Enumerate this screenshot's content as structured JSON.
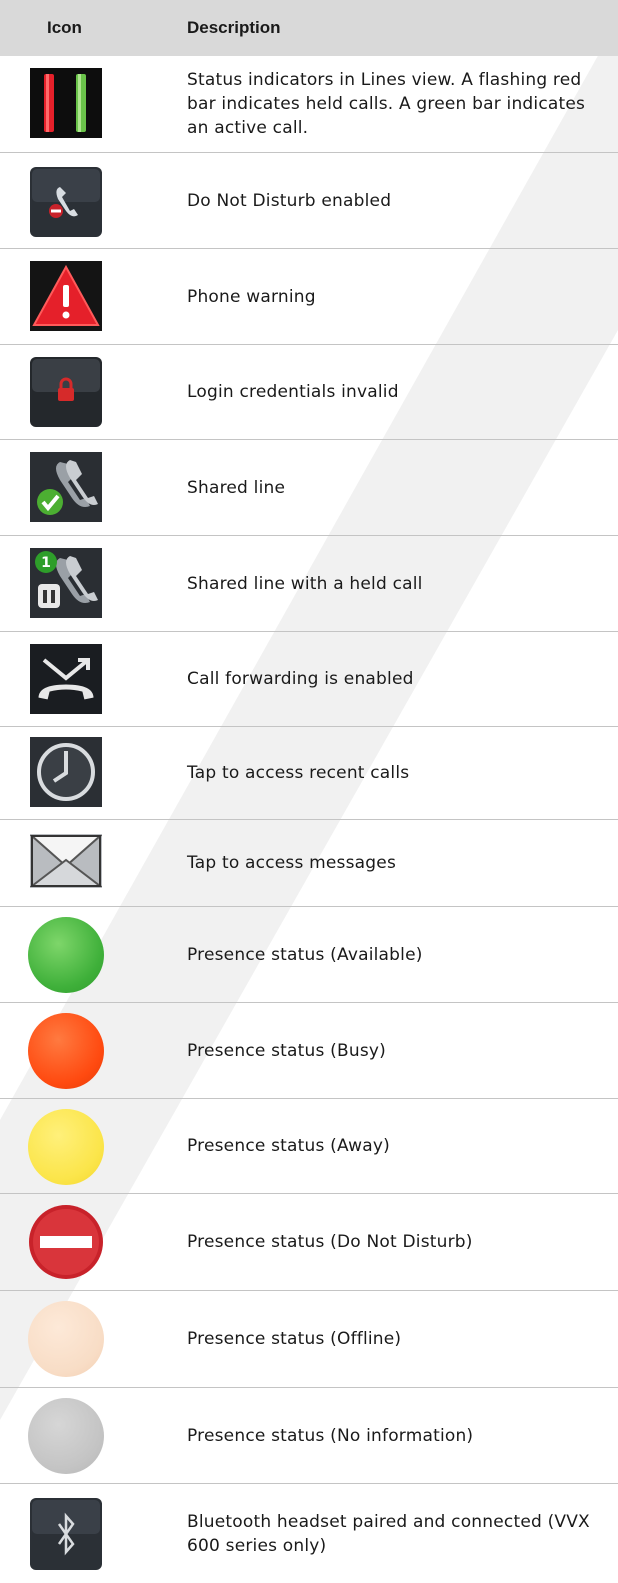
{
  "header": {
    "icon_col": "Icon",
    "description_col": "Description"
  },
  "rows": [
    {
      "icon": "status-bars-icon",
      "description": "Status indicators in Lines view. A flashing red bar indicates held calls. A green bar indicates an active call."
    },
    {
      "icon": "do-not-disturb-handset-icon",
      "description": "Do Not Disturb enabled"
    },
    {
      "icon": "warning-triangle-icon",
      "description": "Phone warning"
    },
    {
      "icon": "lock-icon",
      "description": "Login credentials invalid"
    },
    {
      "icon": "shared-line-icon",
      "description": "Shared line"
    },
    {
      "icon": "shared-line-held-icon",
      "description": "Shared line with a held call"
    },
    {
      "icon": "call-forward-icon",
      "description": "Call forwarding is enabled"
    },
    {
      "icon": "clock-icon",
      "description": "Tap to access recent calls"
    },
    {
      "icon": "envelope-icon",
      "description": "Tap to access messages"
    },
    {
      "icon": "presence-available-icon",
      "description": "Presence status (Available)"
    },
    {
      "icon": "presence-busy-icon",
      "description": "Presence status (Busy)"
    },
    {
      "icon": "presence-away-icon",
      "description": "Presence status (Away)"
    },
    {
      "icon": "presence-dnd-icon",
      "description": "Presence status (Do Not Disturb)"
    },
    {
      "icon": "presence-offline-icon",
      "description": "Presence status (Offline)"
    },
    {
      "icon": "presence-no-info-icon",
      "description": "Presence status (No information)"
    },
    {
      "icon": "bluetooth-icon",
      "description": "Bluetooth headset paired and connected (VVX 600 series only)"
    }
  ],
  "colors": {
    "header_bg": "#d9d9d9",
    "available": "#3fb03a",
    "busy": "#ff4a10",
    "away": "#fbe54a",
    "dnd": "#c8222a",
    "offline": "#f8ddc6",
    "no_info": "#c4c4c4"
  }
}
